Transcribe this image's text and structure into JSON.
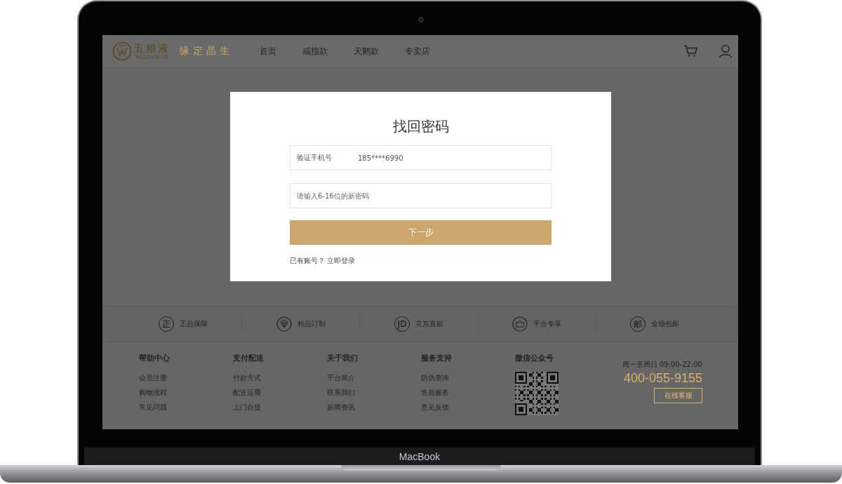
{
  "header": {
    "logo": {
      "chinese": "五粮液",
      "latin": "WULIANGYE"
    },
    "slogan": "缘定晶生",
    "nav": [
      {
        "label": "首页"
      },
      {
        "label": "戒指款"
      },
      {
        "label": "天鹅款"
      },
      {
        "label": "专卖店"
      }
    ]
  },
  "dialog": {
    "title": "找回密码",
    "fields": [
      {
        "label": "验证手机号",
        "value": "185****6990"
      },
      {
        "placeholder": "请输入6-16位的新密码"
      }
    ],
    "button": "下一步",
    "login_prompt": {
      "text": "已有账号？",
      "link": "立即登录"
    }
  },
  "services": [
    {
      "kind": "glyph",
      "glyph": "正",
      "label": "正品保障"
    },
    {
      "kind": "diamond",
      "label": "精品订制"
    },
    {
      "kind": "glyph",
      "glyph": "JD",
      "label": "京东直邮"
    },
    {
      "kind": "crown",
      "label": "平台专享"
    },
    {
      "kind": "glyph",
      "glyph": "邮",
      "label": "全场包邮"
    }
  ],
  "footer": {
    "columns": [
      {
        "title": "帮助中心",
        "links": [
          "会员注册",
          "购物流程",
          "常见问题"
        ]
      },
      {
        "title": "支付配送",
        "links": [
          "付款方式",
          "配送运费",
          "上门自提"
        ]
      },
      {
        "title": "关于我们",
        "links": [
          "平台简介",
          "联系我们",
          "新闻资讯"
        ]
      },
      {
        "title": "服务支持",
        "links": [
          "防伪查询",
          "售后服务",
          "意见反馈"
        ]
      }
    ],
    "wechat": {
      "title": "微信公众号"
    },
    "contact": {
      "hours": "周一至周日 09:00-22:00",
      "phone": "400-055-9155",
      "button": "在线客服"
    }
  },
  "device": {
    "label": "MacBook"
  }
}
